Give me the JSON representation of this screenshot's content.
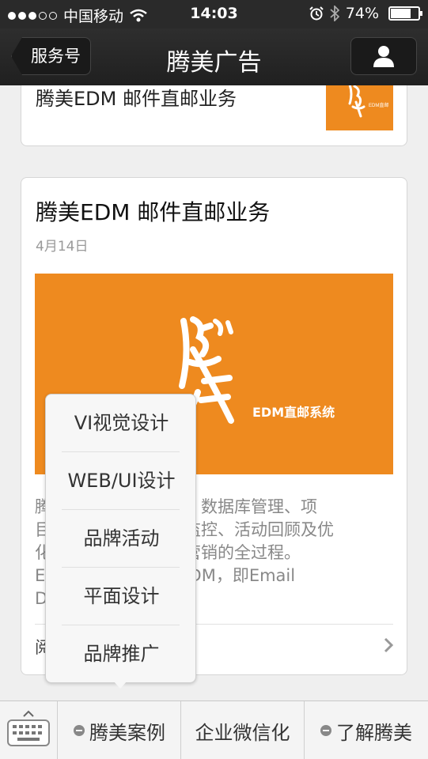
{
  "status_bar": {
    "carrier": "中国移动",
    "time": "14:03",
    "battery_text": "74%",
    "battery_level": 0.74,
    "signal_filled": 3,
    "signal_total": 5
  },
  "nav": {
    "back_label": "服务号",
    "title": "腾美广告",
    "profile_icon": "person-icon"
  },
  "articles": [
    {
      "title": "腾美EDM 邮件直邮业务"
    },
    {
      "title": "腾美EDM 邮件直邮业务",
      "date": "4月14日",
      "banner_text": "EDM直邮系统",
      "summary_lines": [
        "腾　　　　　　包括：数据库管理、项",
        "目　　　　　　质量监控、活动回顾及优",
        "化　　　　　　邮件营销的全过程。",
        "E　　　　　　营销EDM，即Email",
        "D"
      ],
      "read_more": "阅"
    }
  ],
  "popup_menu": {
    "items": [
      "VI视觉设计",
      "WEB/UI设计",
      "品牌活动",
      "平面设计",
      "品牌推广"
    ]
  },
  "bottom_menu": {
    "keyboard_icon": "keyboard-icon",
    "tabs": [
      {
        "label": "腾美案例",
        "has_menu": true
      },
      {
        "label": "企业微信化",
        "has_menu": false
      },
      {
        "label": "了解腾美",
        "has_menu": true
      }
    ]
  },
  "colors": {
    "banner_orange": "#ee8a1f",
    "nav_bg": "#262626"
  }
}
